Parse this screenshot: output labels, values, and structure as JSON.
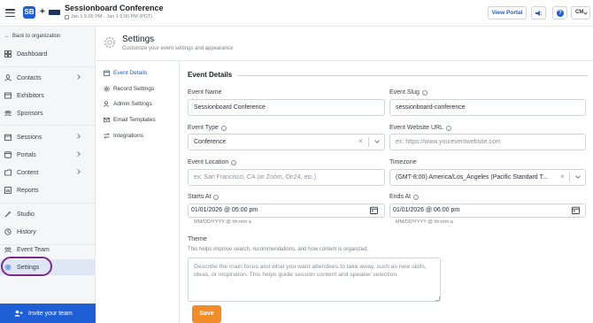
{
  "topbar": {
    "app_logo_text": "SB",
    "plus": "+",
    "event_title": "Sessionboard Conference",
    "event_dates": "Jan 1 5:00 PM - Jan 1 6:00 PM (PDT)",
    "view_portal_label": "View Portal",
    "help_label": "?",
    "user_initials": "CM"
  },
  "sidebar": {
    "back_label": "Back to organization",
    "items": [
      {
        "label": "Dashboard",
        "icon": "dashboard-icon"
      },
      {
        "label": "Contacts",
        "icon": "person-icon"
      },
      {
        "label": "Exhibitors",
        "icon": "storefront-icon"
      },
      {
        "label": "Sponsors",
        "icon": "group-icon"
      },
      {
        "label": "Sessions",
        "icon": "calendar-icon"
      },
      {
        "label": "Portals",
        "icon": "portal-icon"
      },
      {
        "label": "Content",
        "icon": "folder-icon"
      },
      {
        "label": "Reports",
        "icon": "chart-icon"
      },
      {
        "label": "Studio",
        "icon": "wand-icon"
      },
      {
        "label": "History",
        "icon": "history-icon"
      },
      {
        "label": "Event Team",
        "icon": "team-icon"
      },
      {
        "label": "Settings",
        "icon": "gear-icon"
      }
    ],
    "invite_label": "Invite your team"
  },
  "settings": {
    "title": "Settings",
    "subtitle": "Customize your event settings and appearance",
    "subnav": [
      {
        "label": "Event Details",
        "icon": "calendar-icon"
      },
      {
        "label": "Record Settings",
        "icon": "gear-icon"
      },
      {
        "label": "Admin Settings",
        "icon": "admin-icon"
      },
      {
        "label": "Email Templates",
        "icon": "mail-icon"
      },
      {
        "label": "Integrations",
        "icon": "arrows-icon"
      }
    ]
  },
  "form": {
    "section_title": "Event Details",
    "event_name": {
      "label": "Event Name",
      "value": "Sessionboard Conference"
    },
    "event_slug": {
      "label": "Event Slug",
      "value": "sessionboard-conference"
    },
    "event_type": {
      "label": "Event Type",
      "value": "Conference"
    },
    "event_website": {
      "label": "Event Website URL",
      "placeholder": "ex: https://www.youreventwebsite.com"
    },
    "event_location": {
      "label": "Event Location",
      "placeholder": "ex: San Francisco, CA (or Zoom, On24, etc.)"
    },
    "timezone": {
      "label": "Timezone",
      "value": "(GMT-8:00) America/Los_Angeles (Pacific Standard T..."
    },
    "starts_at": {
      "label": "Starts At",
      "value": "01/01/2026 @ 05:00 pm",
      "hint": "MM/DD/YYYY @ hh:mm a"
    },
    "ends_at": {
      "label": "Ends At",
      "value": "01/01/2026 @ 06:00 pm",
      "hint": "MM/DD/YYYY @ hh:mm a"
    },
    "theme": {
      "label": "Theme",
      "help": "This helps improve search, recommendations, and how content is organized.",
      "placeholder": "Describe the main focus and what you want attendees to take away, such as new skills, ideas, or inspiration. This helps guide session content and speaker selection."
    },
    "save_label": "Save",
    "clear_symbol": "×",
    "info_symbol": "i"
  },
  "colors": {
    "brand_blue": "#1f5fd6",
    "save_orange": "#f28c28",
    "highlight_ring": "#7a2a8c",
    "active_nav_bg": "#dfe6f5"
  }
}
